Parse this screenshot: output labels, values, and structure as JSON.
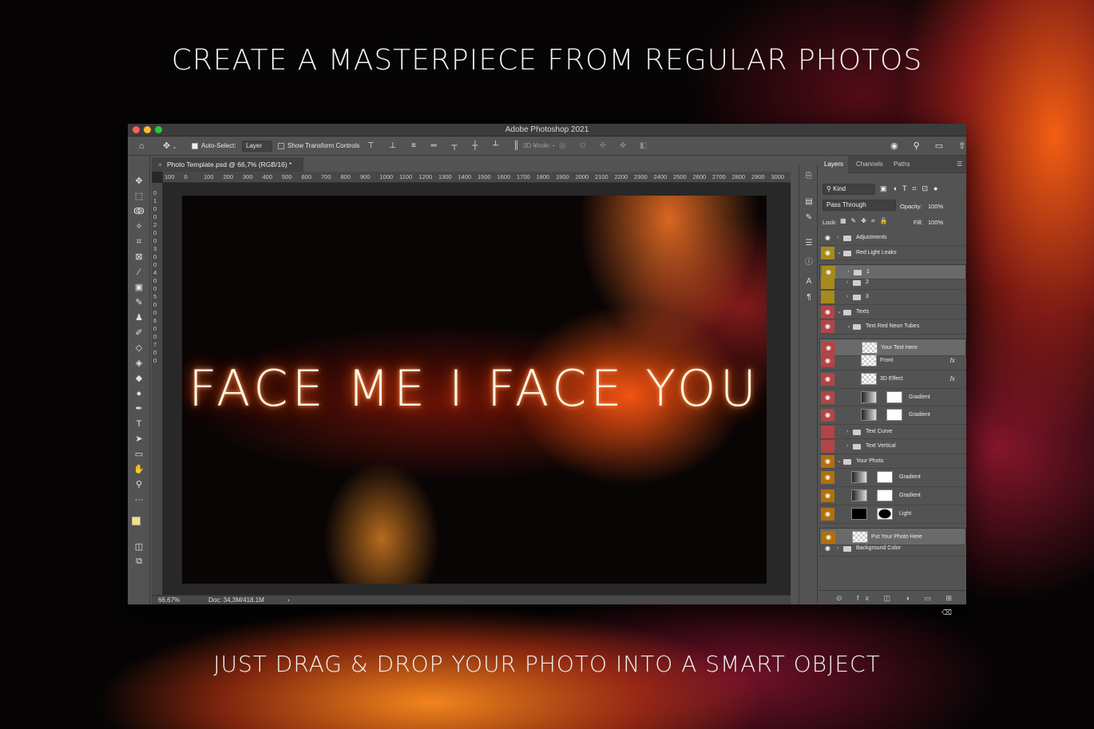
{
  "headline_top": "CREATE A MASTERPIECE FROM REGULAR PHOTOS",
  "headline_bottom": "JUST DRAG & DROP YOUR PHOTO INTO A SMART OBJECT",
  "window": {
    "title": "Adobe Photoshop 2021"
  },
  "options": {
    "auto_select_label": "Auto-Select:",
    "auto_select_value": "Layer",
    "transform_label": "Show Transform Controls",
    "mode_3d_label": "3D Mode:"
  },
  "document": {
    "tab_title": "Photo Template.psd @ 66,7% (RGB/16) *",
    "canvas_text": "FACE ME I FACE YOU",
    "zoom": "66,67%",
    "doc_info": "Doc: 34,3M/418,1M",
    "ruler_ticks": [
      "100",
      "0",
      "100",
      "200",
      "300",
      "400",
      "500",
      "600",
      "700",
      "800",
      "900",
      "1000",
      "1100",
      "1200",
      "1300",
      "1400",
      "1500",
      "1600",
      "1700",
      "1800",
      "1900",
      "2000",
      "2100",
      "2200",
      "2300",
      "2400",
      "2500",
      "2600",
      "2700",
      "2800",
      "2900",
      "3000"
    ],
    "ruler_v_ticks": [
      "0",
      "1",
      "0",
      "0",
      "2",
      "0",
      "0",
      "3",
      "0",
      "0",
      "4",
      "0",
      "0",
      "5",
      "0",
      "0",
      "6",
      "0",
      "0",
      "7",
      "0",
      "0"
    ]
  },
  "panel": {
    "tabs": [
      "Layers",
      "Channels",
      "Paths"
    ],
    "kind_label": "Kind",
    "blend_mode": "Pass Through",
    "opacity_label": "Opacity:",
    "opacity_value": "100%",
    "lock_label": "Lock:",
    "fill_label": "Fill:",
    "fill_value": "100%",
    "fx_label": "fx",
    "layers": [
      {
        "name": "Adjustments",
        "color": "",
        "type": "folder",
        "indent": 0,
        "collapsed": true
      },
      {
        "name": "Red Light Leaks",
        "color": "#a58a1c",
        "type": "folder",
        "indent": 0,
        "collapsed": false
      },
      {
        "name": "1",
        "color": "#a58a1c",
        "type": "folder",
        "indent": 1,
        "collapsed": true,
        "selected": true
      },
      {
        "name": "2",
        "color": "#a58a1c",
        "type": "folder",
        "indent": 1,
        "collapsed": true,
        "hidden": true
      },
      {
        "name": "3",
        "color": "#a58a1c",
        "type": "folder",
        "indent": 1,
        "collapsed": true,
        "hidden": true
      },
      {
        "name": "Texts",
        "color": "#b24545",
        "type": "folder",
        "indent": 0,
        "collapsed": false
      },
      {
        "name": "Text Red Neon Tubes",
        "color": "#b24545",
        "type": "folder",
        "indent": 1,
        "collapsed": false
      },
      {
        "name": "Your Text Here",
        "color": "#b24545",
        "type": "smart",
        "indent": 2,
        "selected": true
      },
      {
        "name": "Front",
        "color": "#b24545",
        "type": "smart",
        "indent": 2,
        "fx": true
      },
      {
        "name": "3D Effect",
        "color": "#b24545",
        "type": "smart",
        "indent": 2,
        "fx": true
      },
      {
        "name": "Gradient",
        "color": "#b24545",
        "type": "adjust",
        "indent": 2
      },
      {
        "name": "Gradient",
        "color": "#b24545",
        "type": "adjust",
        "indent": 2
      },
      {
        "name": "Text Curve",
        "color": "#b24545",
        "type": "folder",
        "indent": 1,
        "collapsed": true,
        "hidden": true
      },
      {
        "name": "Text Vertical",
        "color": "#b24545",
        "type": "folder",
        "indent": 1,
        "collapsed": true,
        "hidden": true
      },
      {
        "name": "Your Photo",
        "color": "#b0700f",
        "type": "folder",
        "indent": 0,
        "collapsed": false
      },
      {
        "name": "Gradient",
        "color": "#b0700f",
        "type": "adjust",
        "indent": 1
      },
      {
        "name": "Gradient",
        "color": "#b0700f",
        "type": "adjust",
        "indent": 1
      },
      {
        "name": "Light",
        "color": "#b0700f",
        "type": "light",
        "indent": 1
      },
      {
        "name": "Put Your Photo Here",
        "color": "#b0700f",
        "type": "smart",
        "indent": 1,
        "selected": true
      },
      {
        "name": "Background Color",
        "color": "",
        "type": "folder",
        "indent": 0,
        "collapsed": true
      }
    ]
  },
  "icons": {
    "home": "home-icon",
    "move": "move-tool-icon",
    "eye": "eye-icon",
    "folder": "folder-icon"
  },
  "colors": {
    "accent_red_label": "#b24545",
    "accent_yellow_label": "#a58a1c",
    "accent_orange_label": "#b0700f"
  }
}
